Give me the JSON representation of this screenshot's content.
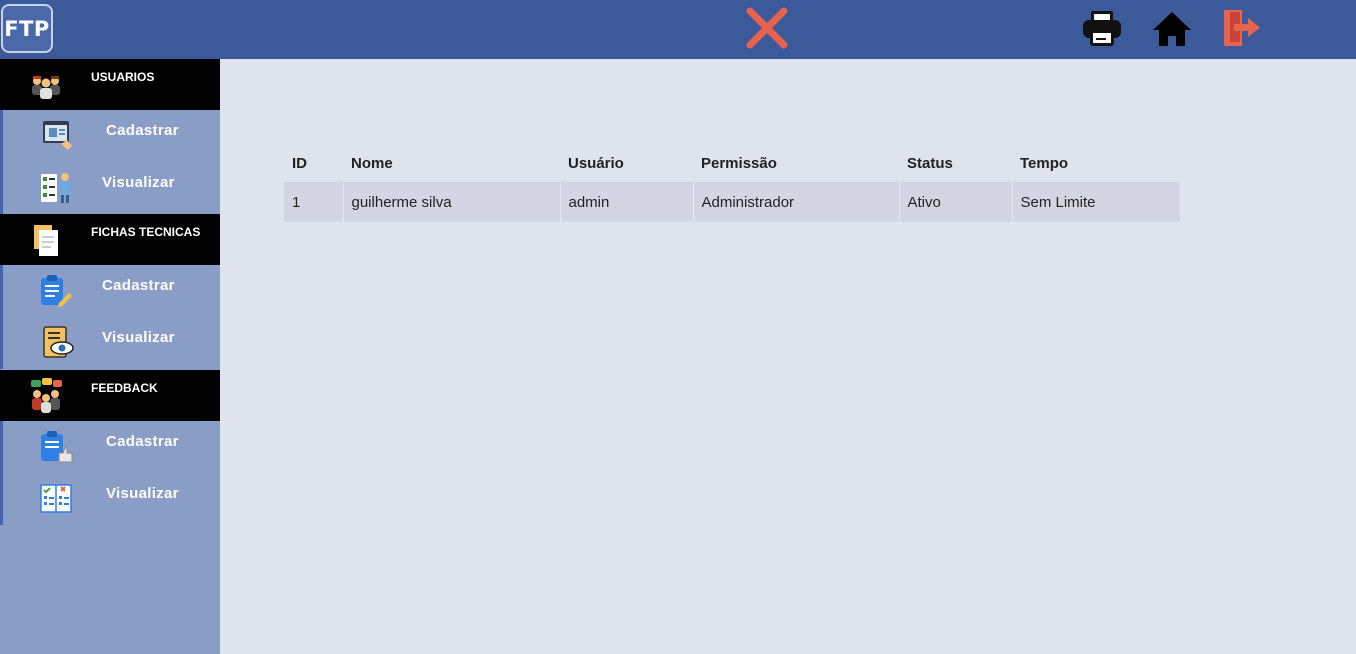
{
  "header": {
    "logo": "FTP",
    "close_icon": "close-x-icon",
    "print_icon": "printer-icon",
    "home_icon": "home-icon",
    "logout_icon": "exit-door-icon"
  },
  "sidebar": {
    "sections": [
      {
        "title": "USUARIOS",
        "icon": "users-group-icon",
        "items": [
          {
            "label": "Cadastrar",
            "icon": "register-user-icon"
          },
          {
            "label": "Visualizar",
            "icon": "view-users-icon"
          }
        ]
      },
      {
        "title": "FICHAS TECNICAS",
        "icon": "documents-icon",
        "items": [
          {
            "label": "Cadastrar",
            "icon": "clipboard-edit-icon"
          },
          {
            "label": "Visualizar",
            "icon": "document-view-icon"
          }
        ]
      },
      {
        "title": "FEEDBACK",
        "icon": "feedback-people-icon",
        "items": [
          {
            "label": "Cadastrar",
            "icon": "clipboard-like-icon"
          },
          {
            "label": "Visualizar",
            "icon": "checklist-icon"
          }
        ]
      }
    ]
  },
  "table": {
    "headers": [
      "ID",
      "Nome",
      "Usuário",
      "Permissão",
      "Status",
      "Tempo"
    ],
    "rows": [
      [
        "1",
        "guilherme silva",
        "admin",
        "Administrador",
        "Ativo",
        "Sem Limite"
      ]
    ]
  },
  "colors": {
    "topbar": "#3c5a9a",
    "sidebar": "#8a9dc6",
    "section_header": "#000000",
    "content_bg": "#dfe3ee",
    "row_bg": "#d3d6e2",
    "close_red": "#e8614f"
  }
}
